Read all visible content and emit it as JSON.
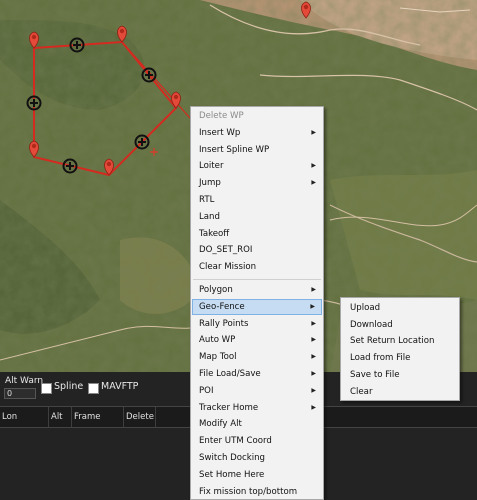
{
  "map": {
    "waypoint_markers": 7,
    "colors": {
      "route": "#d42a20",
      "marker": "#e44a39",
      "sand": "#c9a98a"
    }
  },
  "panel": {
    "alt_warn_label": "Alt Warn",
    "alt_warn_value": "0",
    "spline_label": "Spline",
    "mavftp_label": "MAVFTP",
    "columns": [
      "Lon",
      "Alt",
      "Frame",
      "Delete"
    ]
  },
  "context_menu": {
    "items": [
      {
        "label": "Delete WP",
        "disabled": true
      },
      {
        "label": "Insert Wp",
        "submenu": true
      },
      {
        "label": "Insert Spline WP"
      },
      {
        "label": "Loiter",
        "submenu": true
      },
      {
        "label": "Jump",
        "submenu": true
      },
      {
        "label": "RTL"
      },
      {
        "label": "Land"
      },
      {
        "label": "Takeoff"
      },
      {
        "label": "DO_SET_ROI"
      },
      {
        "label": "Clear Mission"
      },
      {
        "label": "Polygon",
        "submenu": true,
        "separator_before": true
      },
      {
        "label": "Geo-Fence",
        "submenu": true,
        "highlighted": true
      },
      {
        "label": "Rally Points",
        "submenu": true
      },
      {
        "label": "Auto WP",
        "submenu": true
      },
      {
        "label": "Map Tool",
        "submenu": true
      },
      {
        "label": "File Load/Save",
        "submenu": true
      },
      {
        "label": "POI",
        "submenu": true
      },
      {
        "label": "Tracker Home",
        "submenu": true
      },
      {
        "label": "Modify Alt"
      },
      {
        "label": "Enter UTM Coord"
      },
      {
        "label": "Switch Docking"
      },
      {
        "label": "Set Home Here"
      },
      {
        "label": "Fix mission top/bottom"
      }
    ]
  },
  "geofence_submenu": {
    "items": [
      "Upload",
      "Download",
      "Set Return Location",
      "Load from File",
      "Save to File",
      "Clear"
    ]
  }
}
